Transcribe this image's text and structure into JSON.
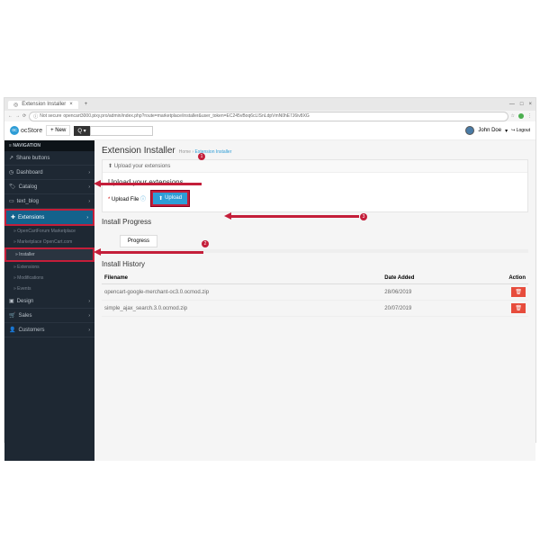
{
  "browser": {
    "tab_title": "Extension Installer",
    "url_security": "Not secure",
    "url": "opencart3000.pixy.pro/admin/index.php?route=marketplace/installer&user_token=EC245vBoq6cLISnLdpVmN0hE7J6iv8XG"
  },
  "brand": {
    "name": "ocStore"
  },
  "topbar": {
    "new_label": "New",
    "user_name": "John Doe",
    "logout": "Logout"
  },
  "nav": {
    "heading": "NAVIGATION",
    "items": [
      {
        "label": "Share buttons"
      },
      {
        "label": "Dashboard"
      },
      {
        "label": "Catalog"
      },
      {
        "label": "text_blog"
      },
      {
        "label": "Extensions"
      }
    ],
    "subs": [
      {
        "label": "OpenCartForum Marketplace"
      },
      {
        "label": "Marketplace OpenCart.com"
      },
      {
        "label": "Installer"
      },
      {
        "label": "Extensions"
      },
      {
        "label": "Modifications"
      },
      {
        "label": "Events"
      }
    ],
    "items2": [
      {
        "label": "Design"
      },
      {
        "label": "Sales"
      },
      {
        "label": "Customers"
      }
    ]
  },
  "page": {
    "title": "Extension Installer",
    "crumb_home": "Home",
    "crumb_here": "Extension Installer",
    "upload_heading": "Upload your extensions",
    "upload_section": "Upload your extensions",
    "upload_file_label": "Upload File",
    "upload_button": "Upload",
    "progress_title": "Install Progress",
    "progress_tab": "Progress",
    "history_title": "Install History",
    "table": {
      "col_filename": "Filename",
      "col_date": "Date Added",
      "col_action": "Action",
      "rows": [
        {
          "filename": "opencart-google-merchant-oc3.0.ocmod.zip",
          "date": "28/06/2019"
        },
        {
          "filename": "simple_ajax_search.3.0.ocmod.zip",
          "date": "20/07/2019"
        }
      ]
    }
  },
  "callouts": {
    "c1": "1",
    "c2": "2",
    "c3": "3"
  }
}
